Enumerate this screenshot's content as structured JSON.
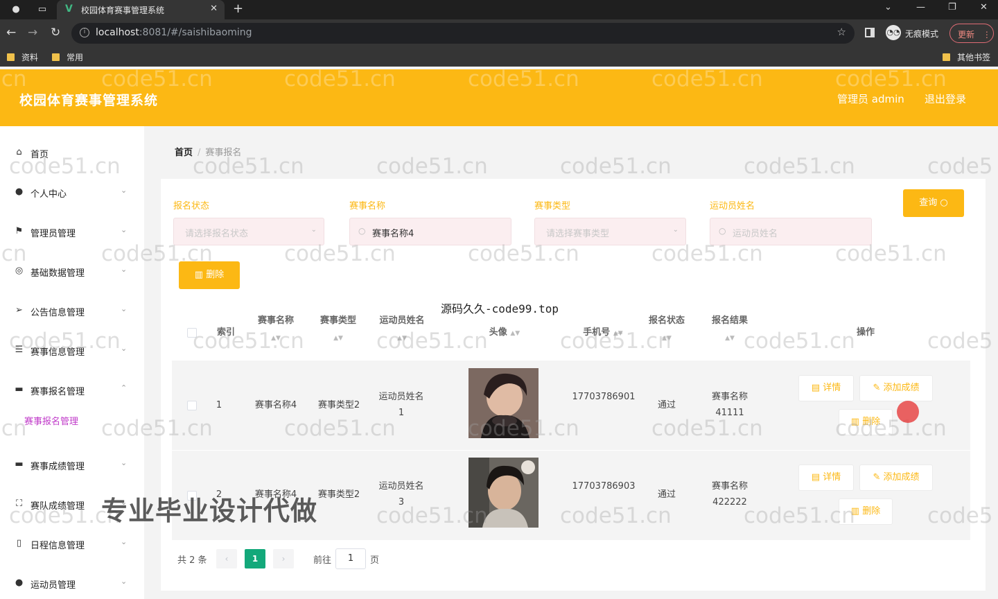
{
  "browser": {
    "tab_title": "校园体育赛事管理系统",
    "tab_logo": "V",
    "url_host": "localhost",
    "url_path": ":8081/#/saishibaoming",
    "incognito_label": "无痕模式",
    "update_label": "更新",
    "bookmarks": [
      "资料",
      "常用"
    ],
    "other_bookmarks": "其他书签",
    "icons": [
      "back-icon",
      "forward-icon",
      "reload-icon",
      "star-icon",
      "incognito-icon",
      "more-icon"
    ]
  },
  "header": {
    "title": "校园体育赛事管理系统",
    "admin_label": "管理员 admin",
    "logout_label": "退出登录",
    "bg_color": "#fcb814"
  },
  "sidebar": {
    "items": [
      {
        "label": "首页",
        "icon": "home-icon"
      },
      {
        "label": "个人中心",
        "icon": "user-icon"
      },
      {
        "label": "管理员管理",
        "icon": "flag-icon"
      },
      {
        "label": "基础数据管理",
        "icon": "circle-icon"
      },
      {
        "label": "公告信息管理",
        "icon": "send-icon"
      },
      {
        "label": "赛事信息管理",
        "icon": "list-icon"
      },
      {
        "label": "赛事报名管理",
        "icon": "monitor-icon"
      },
      {
        "label": "赛事成绩管理",
        "icon": "monitor-icon"
      },
      {
        "label": "赛队成绩管理",
        "icon": "fullscreen-icon"
      },
      {
        "label": "日程信息管理",
        "icon": "phone-icon"
      },
      {
        "label": "运动员管理",
        "icon": "location-icon"
      }
    ],
    "submenu_active": "赛事报名管理"
  },
  "breadcrumb": {
    "home": "首页",
    "current": "赛事报名"
  },
  "search": {
    "fields": [
      {
        "label": "报名状态",
        "placeholder": "请选择报名状态",
        "value": ""
      },
      {
        "label": "赛事名称",
        "placeholder": "",
        "value": "赛事名称4"
      },
      {
        "label": "赛事类型",
        "placeholder": "请选择赛事类型",
        "value": ""
      },
      {
        "label": "运动员姓名",
        "placeholder": "运动员姓名",
        "value": ""
      }
    ],
    "query_label": "查询",
    "delete_label": "删除"
  },
  "table": {
    "caption": "源码久久-code99.top",
    "columns": [
      "索引",
      "赛事名称",
      "赛事类型",
      "运动员姓名",
      "头像",
      "手机号",
      "报名状态",
      "报名结果",
      "操作"
    ],
    "rows": [
      {
        "index": "1",
        "name": "赛事名称4",
        "type": "赛事类型2",
        "athlete": "运动员姓名1",
        "phone": "17703786901",
        "status": "通过",
        "result": "赛事名称41111"
      },
      {
        "index": "2",
        "name": "赛事名称4",
        "type": "赛事类型2",
        "athlete": "运动员姓名3",
        "phone": "17703786903",
        "status": "通过",
        "result": "赛事名称422222"
      }
    ],
    "actions": {
      "detail": "详情",
      "add_score": "添加成绩",
      "delete": "删除"
    }
  },
  "pagination": {
    "total": "共 2 条",
    "current": "1",
    "goto_label": "前往",
    "page_input": "1",
    "page_suffix": "页"
  },
  "overlays": {
    "watermark": "code51.cn",
    "promo": "专业毕业设计代做"
  }
}
